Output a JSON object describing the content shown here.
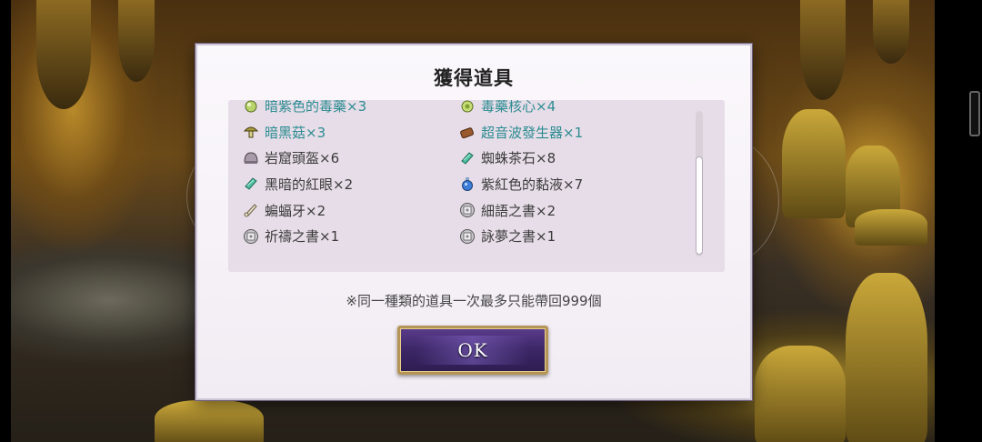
{
  "dialog": {
    "title": "獲得道具",
    "note": "※同一種類的道具一次最多只能帶回999個",
    "ok_label": "OK"
  },
  "items": [
    {
      "name": "暗紫色的毒藥×3",
      "icon": "green-potion-icon",
      "rare": true
    },
    {
      "name": "毒藥核心×4",
      "icon": "green-core-icon",
      "rare": true
    },
    {
      "name": "暗黑菇×3",
      "icon": "mushroom-icon",
      "rare": true
    },
    {
      "name": "超音波發生器×1",
      "icon": "device-icon",
      "rare": true
    },
    {
      "name": "岩窟頭盔×6",
      "icon": "helmet-icon",
      "rare": false
    },
    {
      "name": "蜘蛛茶石×8",
      "icon": "green-gem-icon",
      "rare": false
    },
    {
      "name": "黑暗的紅眼×2",
      "icon": "green-gem-icon",
      "rare": false
    },
    {
      "name": "紫紅色的黏液×7",
      "icon": "blue-flask-icon",
      "rare": false
    },
    {
      "name": "蝙蝠牙×2",
      "icon": "fang-icon",
      "rare": false
    },
    {
      "name": "細語之書×2",
      "icon": "book-icon",
      "rare": false
    },
    {
      "name": "祈禱之書×1",
      "icon": "book-icon",
      "rare": false
    },
    {
      "name": "詠夢之書×1",
      "icon": "book-icon",
      "rare": false
    }
  ],
  "colors": {
    "rare_text": "#2d8c92",
    "normal_text": "#3b3b3b",
    "button_purple": "#3e2869",
    "button_gold": "#b59457"
  }
}
